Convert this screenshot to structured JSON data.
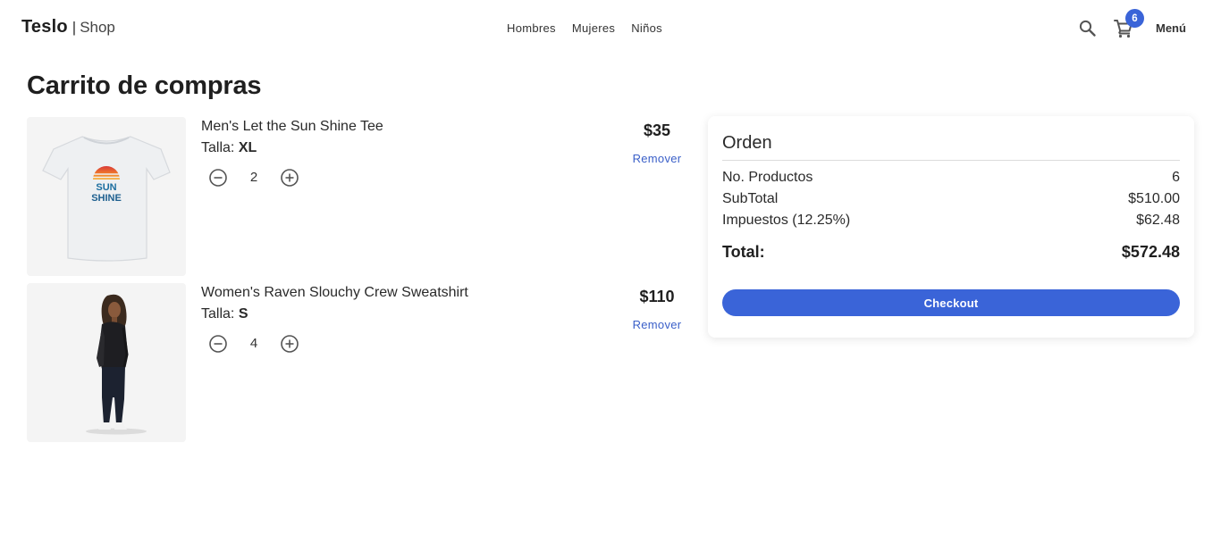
{
  "header": {
    "brand": "Teslo",
    "separator": "|",
    "brand_sub": "Shop",
    "nav": [
      "Hombres",
      "Mujeres",
      "Niños"
    ],
    "cart_count": "6",
    "menu_label": "Menú",
    "icons": {
      "search": "search-icon",
      "cart": "shopping-cart-icon"
    },
    "accent_color": "#3a64d8"
  },
  "page": {
    "title": "Carrito de compras"
  },
  "cart": {
    "items": [
      {
        "title": "Men's Let the Sun Shine Tee",
        "size_label": "Talla:",
        "size": "XL",
        "quantity": "2",
        "price": "$35",
        "remove_label": "Remover",
        "image_text": "SUN SHINE"
      },
      {
        "title": "Women's Raven Slouchy Crew Sweatshirt",
        "size_label": "Talla:",
        "size": "S",
        "quantity": "4",
        "price": "$110",
        "remove_label": "Remover"
      }
    ]
  },
  "summary": {
    "title": "Orden",
    "rows": [
      {
        "label": "No. Productos",
        "value": "6"
      },
      {
        "label": "SubTotal",
        "value": "$510.00"
      },
      {
        "label": "Impuestos (12.25%)",
        "value": "$62.48"
      }
    ],
    "total_label": "Total:",
    "total_value": "$572.48",
    "checkout_label": "Checkout"
  }
}
